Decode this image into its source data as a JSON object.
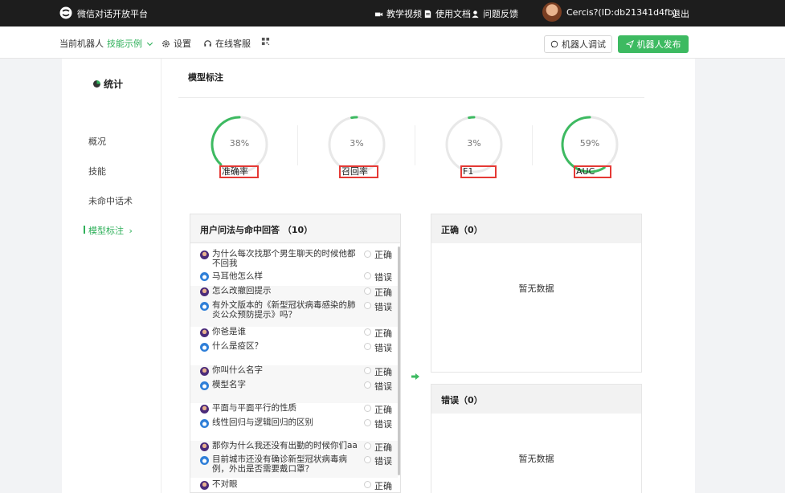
{
  "topbar": {
    "brand": "微信对话开放平台",
    "links": [
      "教学视频",
      "使用文档",
      "问题反馈"
    ],
    "user": "Cercis?(ID:db21341d4fb)",
    "logout": "退出"
  },
  "subbar": {
    "robot_label": "当前机器人",
    "robot_name": "技能示例",
    "settings": "设置",
    "service": "在线客服",
    "debug_button": "机器人调试",
    "publish_button": "机器人发布"
  },
  "sidebar": {
    "title": "统计",
    "items": [
      "概况",
      "技能",
      "未命中话术",
      "模型标注"
    ]
  },
  "section_title": "模型标注",
  "metrics": [
    {
      "label": "准确率",
      "value": "38%",
      "percent": 38
    },
    {
      "label": "召回率",
      "value": "3%",
      "percent": 3
    },
    {
      "label": "F1",
      "value": "3%",
      "percent": 3
    },
    {
      "label": "AUC",
      "value": "59%",
      "percent": 59
    }
  ],
  "question_panel": {
    "title": "用户问法与命中回答 （10）",
    "rows": [
      {
        "q": "为什么每次找那个男生聊天的时候他都不回我",
        "a": "马耳他怎么样",
        "q_tag": "正确",
        "a_tag": "错误"
      },
      {
        "q": "怎么改撤回提示",
        "a": "有外文版本的《新型冠状病毒感染的肺炎公众预防提示》吗？",
        "q_tag": "正确",
        "a_tag": "错误"
      },
      {
        "q": "你爸是谁",
        "a": "什么是疫区？",
        "q_tag": "正确",
        "a_tag": "错误"
      },
      {
        "q": "你叫什么名字",
        "a": "模型名字",
        "q_tag": "正确",
        "a_tag": "错误"
      },
      {
        "q": "平面与平面平行的性质",
        "a": "线性回归与逻辑回归的区别",
        "q_tag": "正确",
        "a_tag": "错误"
      },
      {
        "q": "那你为什么我还没有出勤的时候你们aa",
        "a": "目前城市还没有确诊新型冠状病毒病例，外出是否需要戴口罩？",
        "q_tag": "正确",
        "a_tag": "错误"
      },
      {
        "q": "不对眼",
        "q_tag": "正确"
      }
    ]
  },
  "correct_panel": {
    "title": "正确（0）",
    "empty": "暂无数据"
  },
  "wrong_panel": {
    "title": "错误（0）",
    "empty": "暂无数据"
  },
  "colors": {
    "accent": "#3dba61",
    "highlight": "#e53935",
    "topbar": "#1d1d1d"
  }
}
